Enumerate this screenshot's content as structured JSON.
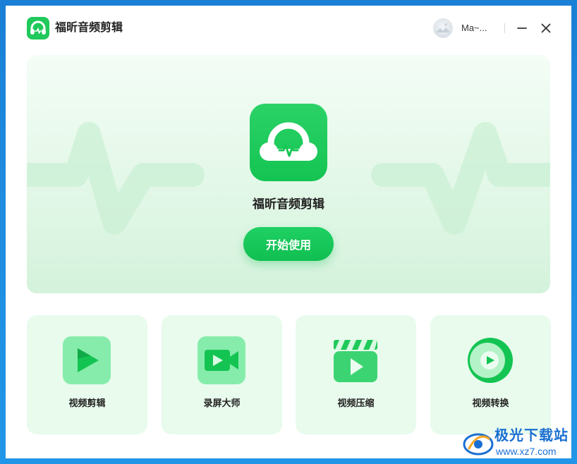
{
  "app": {
    "title": "福昕音频剪辑",
    "user_name": "Ma~...",
    "icons": {
      "logo": "headphones-pulse-icon",
      "minimize": "minimize-icon",
      "close": "close-icon",
      "avatar": "avatar"
    }
  },
  "hero": {
    "app_name": "福昕音频剪辑",
    "start_button_label": "开始使用",
    "icon": "headphones-pulse-icon"
  },
  "tools": [
    {
      "label": "视频剪辑",
      "icon": "play-arrow-icon"
    },
    {
      "label": "录屏大师",
      "icon": "video-camera-icon"
    },
    {
      "label": "视频压缩",
      "icon": "clapperboard-icon"
    },
    {
      "label": "视频转换",
      "icon": "play-circle-icon"
    }
  ],
  "watermark": {
    "name": "极光下载站",
    "url": "www.xz7.com"
  },
  "colors": {
    "brand_green": "#1fc95a",
    "hero_bg": "#e4f8e9",
    "card_bg": "#e8fbed",
    "desktop_blue": "#1e8be0"
  }
}
